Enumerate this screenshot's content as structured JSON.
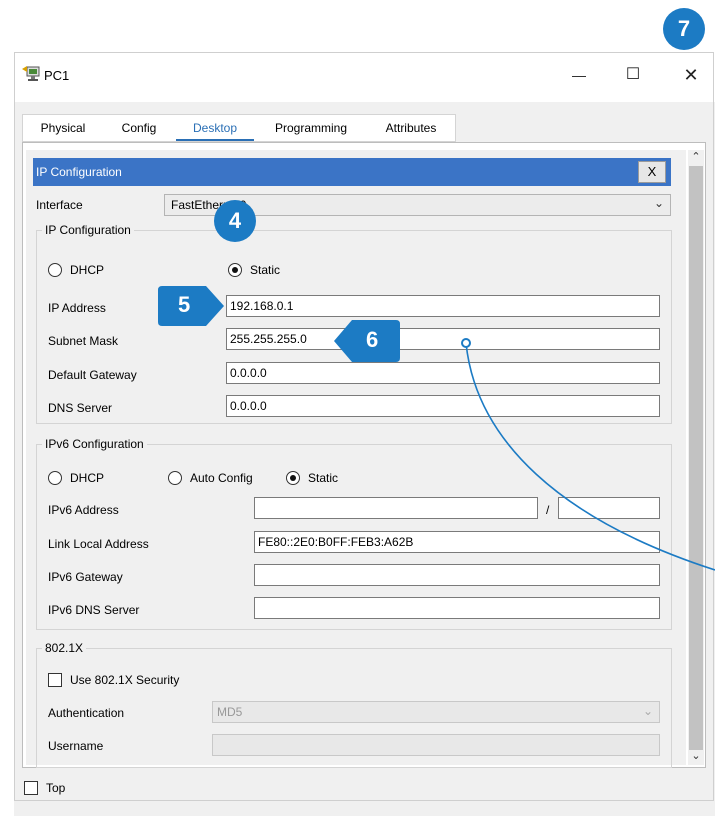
{
  "window": {
    "title": "PC1",
    "minimize_symbol": "—",
    "maximize_symbol": "☐",
    "close_symbol": "✕"
  },
  "tabs": [
    {
      "label": "Physical"
    },
    {
      "label": "Config"
    },
    {
      "label": "Desktop"
    },
    {
      "label": "Programming"
    },
    {
      "label": "Attributes"
    }
  ],
  "ip_config_panel": {
    "header": "IP Configuration",
    "close_label": "X",
    "interface_label": "Interface",
    "interface_value": "FastEthernet0"
  },
  "ipv4": {
    "legend": "IP Configuration",
    "dhcp_label": "DHCP",
    "static_label": "Static",
    "ip_address_label": "IP Address",
    "ip_address_value": "192.168.0.1",
    "subnet_mask_label": "Subnet Mask",
    "subnet_mask_value": "255.255.255.0",
    "default_gateway_label": "Default Gateway",
    "default_gateway_value": "0.0.0.0",
    "dns_server_label": "DNS Server",
    "dns_server_value": "0.0.0.0"
  },
  "ipv6": {
    "legend": "IPv6 Configuration",
    "dhcp_label": "DHCP",
    "auto_config_label": "Auto Config",
    "static_label": "Static",
    "address_label": "IPv6 Address",
    "address_value": "",
    "prefix_separator": "/",
    "prefix_value": "",
    "link_local_label": "Link Local Address",
    "link_local_value": "FE80::2E0:B0FF:FEB3:A62B",
    "gateway_label": "IPv6 Gateway",
    "gateway_value": "",
    "dns_label": "IPv6 DNS Server",
    "dns_value": ""
  },
  "dot1x": {
    "legend": "802.1X",
    "use_security_label": "Use 802.1X Security",
    "authentication_label": "Authentication",
    "authentication_value": "MD5",
    "username_label": "Username",
    "username_value": ""
  },
  "bottom": {
    "top_label": "Top"
  },
  "annotations": {
    "step4": "4",
    "step5": "5",
    "step6": "6",
    "step7": "7"
  },
  "colors": {
    "accent": "#1c7bc4",
    "header_blue": "#3b74c6",
    "active_tab": "#2a6fb5"
  }
}
